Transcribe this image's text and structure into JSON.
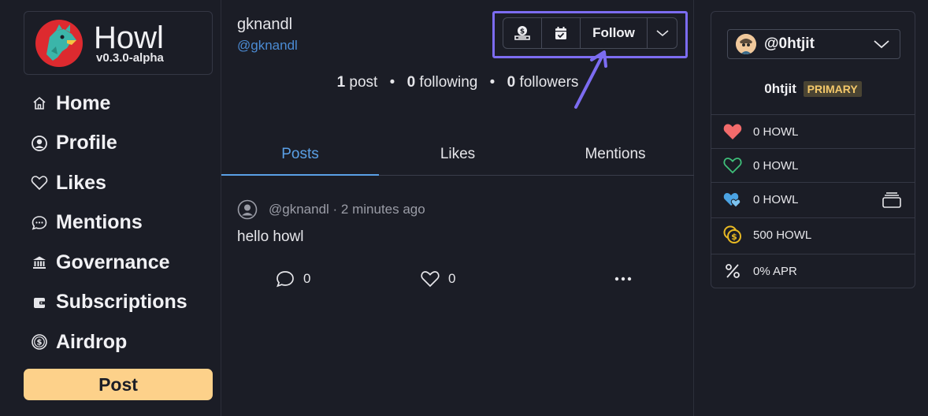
{
  "brand": {
    "name": "Howl",
    "version": "v0.3.0-alpha"
  },
  "nav": [
    {
      "label": "Home",
      "icon": "home-icon"
    },
    {
      "label": "Profile",
      "icon": "user-circle-icon"
    },
    {
      "label": "Likes",
      "icon": "heart-icon"
    },
    {
      "label": "Mentions",
      "icon": "chat-bubble-icon"
    },
    {
      "label": "Governance",
      "icon": "bank-icon"
    },
    {
      "label": "Subscriptions",
      "icon": "wallet-icon"
    },
    {
      "label": "Airdrop",
      "icon": "dollar-coin-icon"
    }
  ],
  "post_button": "Post",
  "profile": {
    "display_name": "gknandl",
    "handle": "@gknandl",
    "actions": {
      "follow_label": "Follow"
    },
    "stats": {
      "posts_count": "1",
      "posts_label": "post",
      "following_count": "0",
      "following_label": "following",
      "followers_count": "0",
      "followers_label": "followers"
    }
  },
  "tabs": [
    {
      "label": "Posts",
      "active": true
    },
    {
      "label": "Likes",
      "active": false
    },
    {
      "label": "Mentions",
      "active": false
    }
  ],
  "feed": [
    {
      "meta": "@gknandl · 2 minutes ago",
      "body": "hello howl",
      "replies": "0",
      "likes": "0"
    }
  ],
  "account": {
    "name": "@0htjit",
    "username": "0htjit",
    "badge": "PRIMARY",
    "balances": [
      {
        "icon": "heart-filled-icon",
        "color": "#f26b6b",
        "text": "0 HOWL"
      },
      {
        "icon": "heart-outline-icon",
        "color": "#3fbf7a",
        "text": "0 HOWL"
      },
      {
        "icon": "hearts-icon",
        "color": "#4ba3e3",
        "text": "0 HOWL"
      },
      {
        "icon": "coins-icon",
        "color": "#e8b923",
        "text": "500 HOWL"
      },
      {
        "icon": "percent-icon",
        "color": "#e6e6ea",
        "text": "0% APR"
      }
    ]
  },
  "colors": {
    "accent": "#5aa0e6",
    "post_button": "#fdd18a",
    "highlight": "#7c6cf1",
    "background": "#1b1d26"
  }
}
